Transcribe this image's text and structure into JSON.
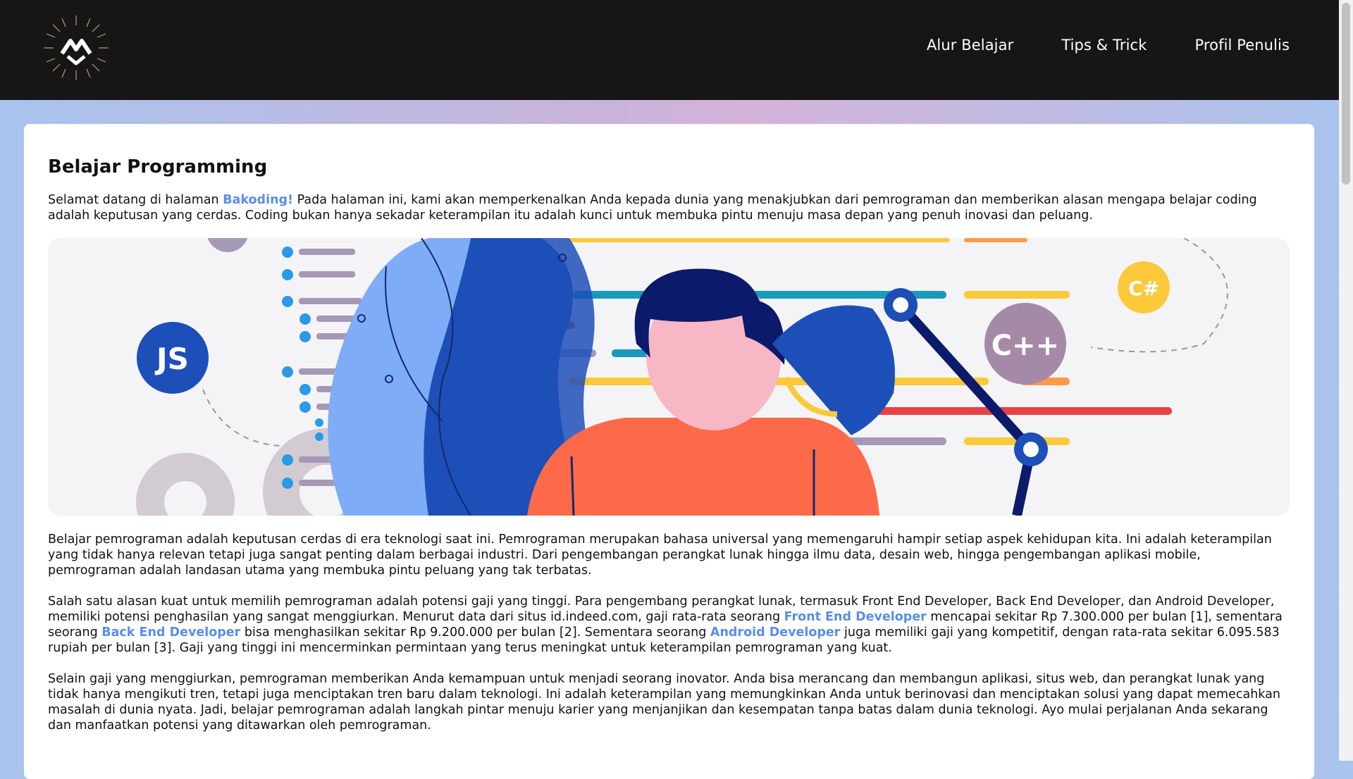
{
  "nav": {
    "items": [
      {
        "label": "Alur Belajar"
      },
      {
        "label": "Tips & Trick"
      },
      {
        "label": "Profil Penulis"
      }
    ]
  },
  "main": {
    "title": "Belajar Programming",
    "intro": {
      "before_link": "Selamat datang di halaman ",
      "link": "Bakoding!",
      "after_link": " Pada halaman ini, kami akan memperkenalkan Anda kepada dunia yang menakjubkan dari pemrograman dan memberikan alasan mengapa belajar coding adalah keputusan yang cerdas. Coding bukan hanya sekadar keterampilan itu adalah kunci untuk membuka pintu menuju masa depan yang penuh inovasi dan peluang."
    },
    "hero": {
      "badges": [
        "JS",
        "C++",
        "C#"
      ]
    },
    "para1": "Belajar pemrograman adalah keputusan cerdas di era teknologi saat ini. Pemrograman merupakan bahasa universal yang memengaruhi hampir setiap aspek kehidupan kita. Ini adalah keterampilan yang tidak hanya relevan tetapi juga sangat penting dalam berbagai industri. Dari pengembangan perangkat lunak hingga ilmu data, desain web, hingga pengembangan aplikasi mobile, pemrograman adalah landasan utama yang membuka pintu peluang yang tak terbatas.",
    "para2": {
      "part1": "Salah satu alasan kuat untuk memilih pemrograman adalah potensi gaji yang tinggi. Para pengembang perangkat lunak, termasuk Front End Developer, Back End Developer, dan Android Developer, memiliki potensi penghasilan yang sangat menggiurkan. Menurut data dari situs id.indeed.com, gaji rata-rata seorang ",
      "link1": "Front End Developer",
      "part2": " mencapai sekitar Rp 7.300.000 per bulan [1], sementara seorang ",
      "link2": "Back End Developer",
      "part3": " bisa menghasilkan sekitar Rp 9.200.000 per bulan [2]. Sementara seorang ",
      "link3": "Android Developer",
      "part4": " juga memiliki gaji yang kompetitif, dengan rata-rata sekitar 6.095.583 rupiah per bulan [3]. Gaji yang tinggi ini mencerminkan permintaan yang terus meningkat untuk keterampilan pemrograman yang kuat."
    },
    "para3": "Selain gaji yang menggiurkan, pemrograman memberikan Anda kemampuan untuk menjadi seorang inovator. Anda bisa merancang dan membangun aplikasi, situs web, dan perangkat lunak yang tidak hanya mengikuti tren, tetapi juga menciptakan tren baru dalam teknologi. Ini adalah keterampilan yang memungkinkan Anda untuk berinovasi dan menciptakan solusi yang dapat memecahkan masalah di dunia nyata. Jadi, belajar pemrograman adalah langkah pintar menuju karier yang menjanjikan dan kesempatan tanpa batas dalam dunia teknologi. Ayo mulai perjalanan Anda sekarang dan manfaatkan potensi yang ditawarkan oleh pemrograman."
  },
  "colors": {
    "navbar": "#161616",
    "link": "#5a8ee6",
    "accent_blue": "#1d4fb8",
    "accent_orange": "#fd6a4a",
    "accent_yellow": "#fcc93a"
  }
}
